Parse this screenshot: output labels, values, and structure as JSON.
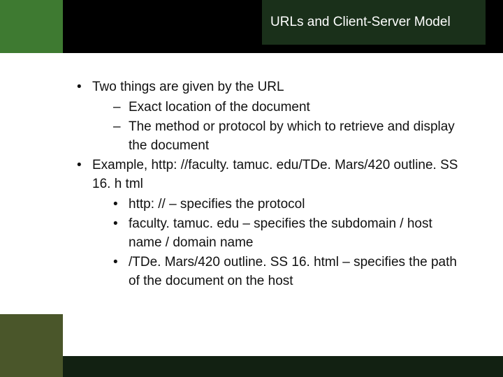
{
  "title": "URLs and Client-Server Model",
  "bullets": {
    "b1": "Two things are given by the URL",
    "b1a": "Exact location of the document",
    "b1b": "The method or protocol by which to retrieve and display the document",
    "b2": "Example, http: //faculty. tamuc. edu/TDe. Mars/420 outline. SS 16. h tml",
    "b2a": "http: // – specifies the protocol",
    "b2b": "faculty. tamuc. edu – specifies the subdomain / host name / domain name",
    "b2c": "/TDe. Mars/420 outline. SS 16. html – specifies the path of the document on the host"
  }
}
